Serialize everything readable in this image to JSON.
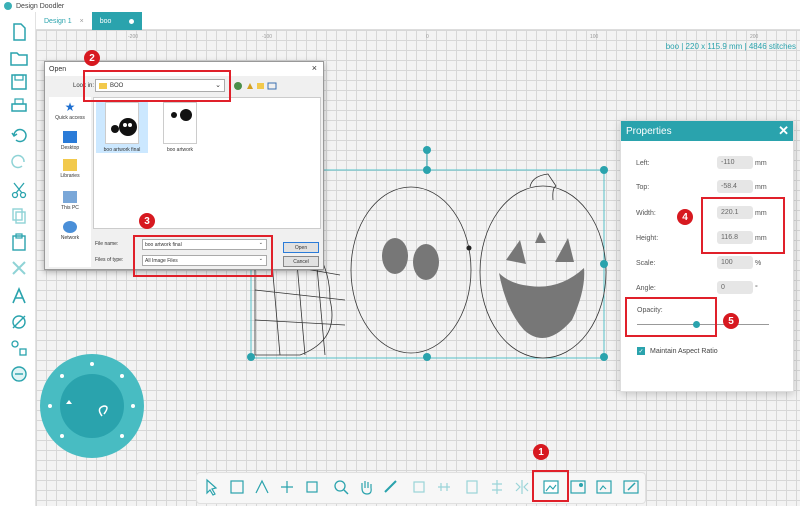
{
  "app": {
    "title": "Design Doodler"
  },
  "tabs": [
    {
      "label": "Design 1",
      "close": "×"
    },
    {
      "label": "boo"
    }
  ],
  "rulers": [
    "-200",
    "-100",
    "0",
    "100",
    "200"
  ],
  "stitch_info": "boo | 220 x 115.9 mm | 4846 stitches",
  "dialog": {
    "title": "Open",
    "close": "×",
    "look_in_label": "Look in:",
    "look_in_value": "BOO",
    "places": [
      "Quick access",
      "Desktop",
      "Libraries",
      "This PC",
      "Network"
    ],
    "files": [
      "boo artwork final",
      "boo artwork"
    ],
    "file_name_label": "File name:",
    "file_name_value": "boo artwork final",
    "file_type_label": "Files of type:",
    "file_type_value": "All Image Files",
    "open_label": "Open",
    "cancel_label": "Cancel"
  },
  "properties": {
    "title": "Properties",
    "close": "✕",
    "left": {
      "label": "Left:",
      "value": "-110",
      "unit": "mm"
    },
    "top": {
      "label": "Top:",
      "value": "-58.4",
      "unit": "mm"
    },
    "width": {
      "label": "Width:",
      "value": "220.1",
      "unit": "mm"
    },
    "height": {
      "label": "Height:",
      "value": "116.8",
      "unit": "mm"
    },
    "scale": {
      "label": "Scale:",
      "value": "100",
      "unit": "%"
    },
    "angle": {
      "label": "Angle:",
      "value": "0",
      "unit": "°"
    },
    "opacity": {
      "label": "Opacity:",
      "level": 0.45
    },
    "aspect": {
      "label": "Maintain Aspect Ratio",
      "checked": true
    }
  },
  "badges": [
    "1",
    "2",
    "3",
    "4",
    "5"
  ],
  "colors": {
    "accent": "#2aa3ad",
    "highlight": "#e0202a",
    "badge": "#d71920"
  }
}
